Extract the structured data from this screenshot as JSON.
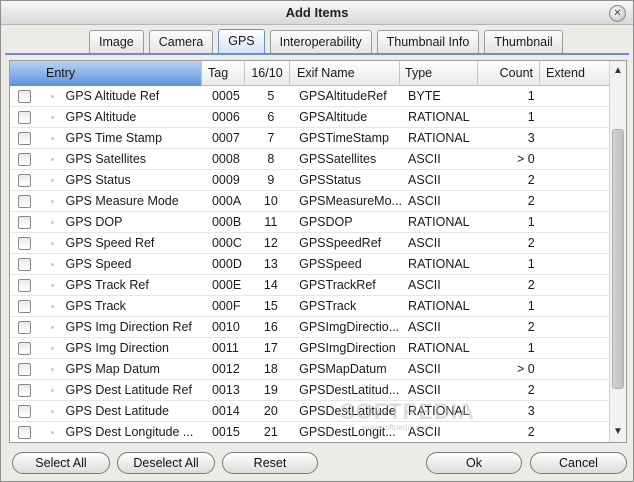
{
  "window": {
    "title": "Add Items",
    "close_glyph": "✕"
  },
  "tabs": [
    {
      "label": "Image",
      "active": false
    },
    {
      "label": "Camera",
      "active": false
    },
    {
      "label": "GPS",
      "active": true
    },
    {
      "label": "Interoperability",
      "active": false
    },
    {
      "label": "Thumbnail Info",
      "active": false
    },
    {
      "label": "Thumbnail",
      "active": false
    }
  ],
  "table": {
    "columns": {
      "entry": "Entry",
      "tag": "Tag",
      "idx": "16/10",
      "exif": "Exif Name",
      "type": "Type",
      "count": "Count",
      "extend": "Extend"
    },
    "rows": [
      {
        "entry": "GPS Altitude Ref",
        "tag": "0005",
        "idx": "5",
        "exif": "GPSAltitudeRef",
        "type": "BYTE",
        "count": "1",
        "checked": false
      },
      {
        "entry": "GPS Altitude",
        "tag": "0006",
        "idx": "6",
        "exif": "GPSAltitude",
        "type": "RATIONAL",
        "count": "1",
        "checked": false
      },
      {
        "entry": "GPS Time Stamp",
        "tag": "0007",
        "idx": "7",
        "exif": "GPSTimeStamp",
        "type": "RATIONAL",
        "count": "3",
        "checked": false
      },
      {
        "entry": "GPS Satellites",
        "tag": "0008",
        "idx": "8",
        "exif": "GPSSatellites",
        "type": "ASCII",
        "count": "> 0",
        "checked": false
      },
      {
        "entry": "GPS Status",
        "tag": "0009",
        "idx": "9",
        "exif": "GPSStatus",
        "type": "ASCII",
        "count": "2",
        "checked": false
      },
      {
        "entry": "GPS Measure Mode",
        "tag": "000A",
        "idx": "10",
        "exif": "GPSMeasureMo...",
        "type": "ASCII",
        "count": "2",
        "checked": false
      },
      {
        "entry": "GPS DOP",
        "tag": "000B",
        "idx": "11",
        "exif": "GPSDOP",
        "type": "RATIONAL",
        "count": "1",
        "checked": false
      },
      {
        "entry": "GPS Speed Ref",
        "tag": "000C",
        "idx": "12",
        "exif": "GPSSpeedRef",
        "type": "ASCII",
        "count": "2",
        "checked": false
      },
      {
        "entry": "GPS Speed",
        "tag": "000D",
        "idx": "13",
        "exif": "GPSSpeed",
        "type": "RATIONAL",
        "count": "1",
        "checked": false
      },
      {
        "entry": "GPS Track Ref",
        "tag": "000E",
        "idx": "14",
        "exif": "GPSTrackRef",
        "type": "ASCII",
        "count": "2",
        "checked": false
      },
      {
        "entry": "GPS Track",
        "tag": "000F",
        "idx": "15",
        "exif": "GPSTrack",
        "type": "RATIONAL",
        "count": "1",
        "checked": false
      },
      {
        "entry": "GPS Img Direction Ref",
        "tag": "0010",
        "idx": "16",
        "exif": "GPSImgDirectio...",
        "type": "ASCII",
        "count": "2",
        "checked": false
      },
      {
        "entry": "GPS Img Direction",
        "tag": "0011",
        "idx": "17",
        "exif": "GPSImgDirection",
        "type": "RATIONAL",
        "count": "1",
        "checked": false
      },
      {
        "entry": "GPS Map Datum",
        "tag": "0012",
        "idx": "18",
        "exif": "GPSMapDatum",
        "type": "ASCII",
        "count": "> 0",
        "checked": false
      },
      {
        "entry": "GPS Dest Latitude Ref",
        "tag": "0013",
        "idx": "19",
        "exif": "GPSDestLatitud...",
        "type": "ASCII",
        "count": "2",
        "checked": false
      },
      {
        "entry": "GPS Dest Latitude",
        "tag": "0014",
        "idx": "20",
        "exif": "GPSDestLatitude",
        "type": "RATIONAL",
        "count": "3",
        "checked": false
      },
      {
        "entry": "GPS Dest Longitude ...",
        "tag": "0015",
        "idx": "21",
        "exif": "GPSDestLongit...",
        "type": "ASCII",
        "count": "2",
        "checked": false
      }
    ]
  },
  "scrollbar": {
    "up_glyph": "▲",
    "down_glyph": "▼"
  },
  "watermark": {
    "text": "SOFTPEDIA",
    "sub": "www.softpedia.com"
  },
  "buttons": {
    "select_all": "Select All",
    "deselect_all": "Deselect All",
    "reset": "Reset",
    "ok": "Ok",
    "cancel": "Cancel"
  }
}
